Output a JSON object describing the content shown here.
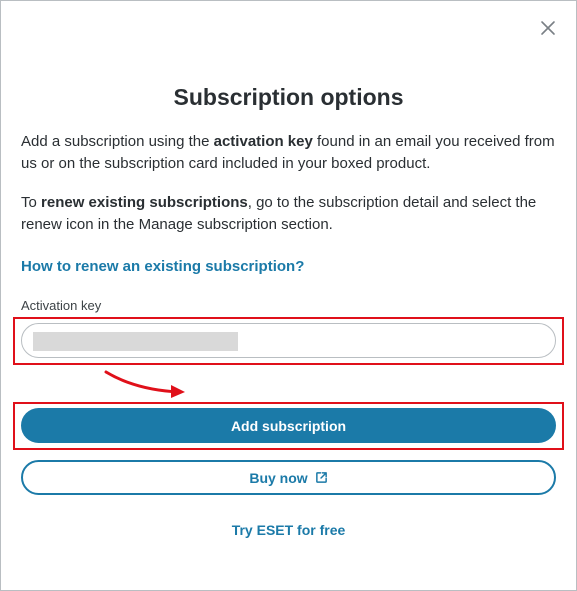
{
  "dialog": {
    "title": "Subscription options",
    "intro": {
      "before": "Add a subscription using the ",
      "bold": "activation key",
      "after": " found in an email you received from us or on the subscription card included in your boxed product."
    },
    "renew": {
      "before": "To ",
      "bold": "renew existing subscriptions",
      "after": ", go to the subscription detail and select the renew icon in the Manage subscription section."
    },
    "help_link": "How to renew an existing subscription?",
    "activation_key": {
      "label": "Activation key",
      "value": "",
      "placeholder": ""
    },
    "add_button": "Add subscription",
    "buy_button": "Buy now",
    "try_link": "Try ESET for free"
  },
  "colors": {
    "accent": "#1b7aa8",
    "highlight": "#e0101a",
    "text": "#2a2f33"
  },
  "icons": {
    "close": "close-icon",
    "external": "external-link-icon"
  }
}
